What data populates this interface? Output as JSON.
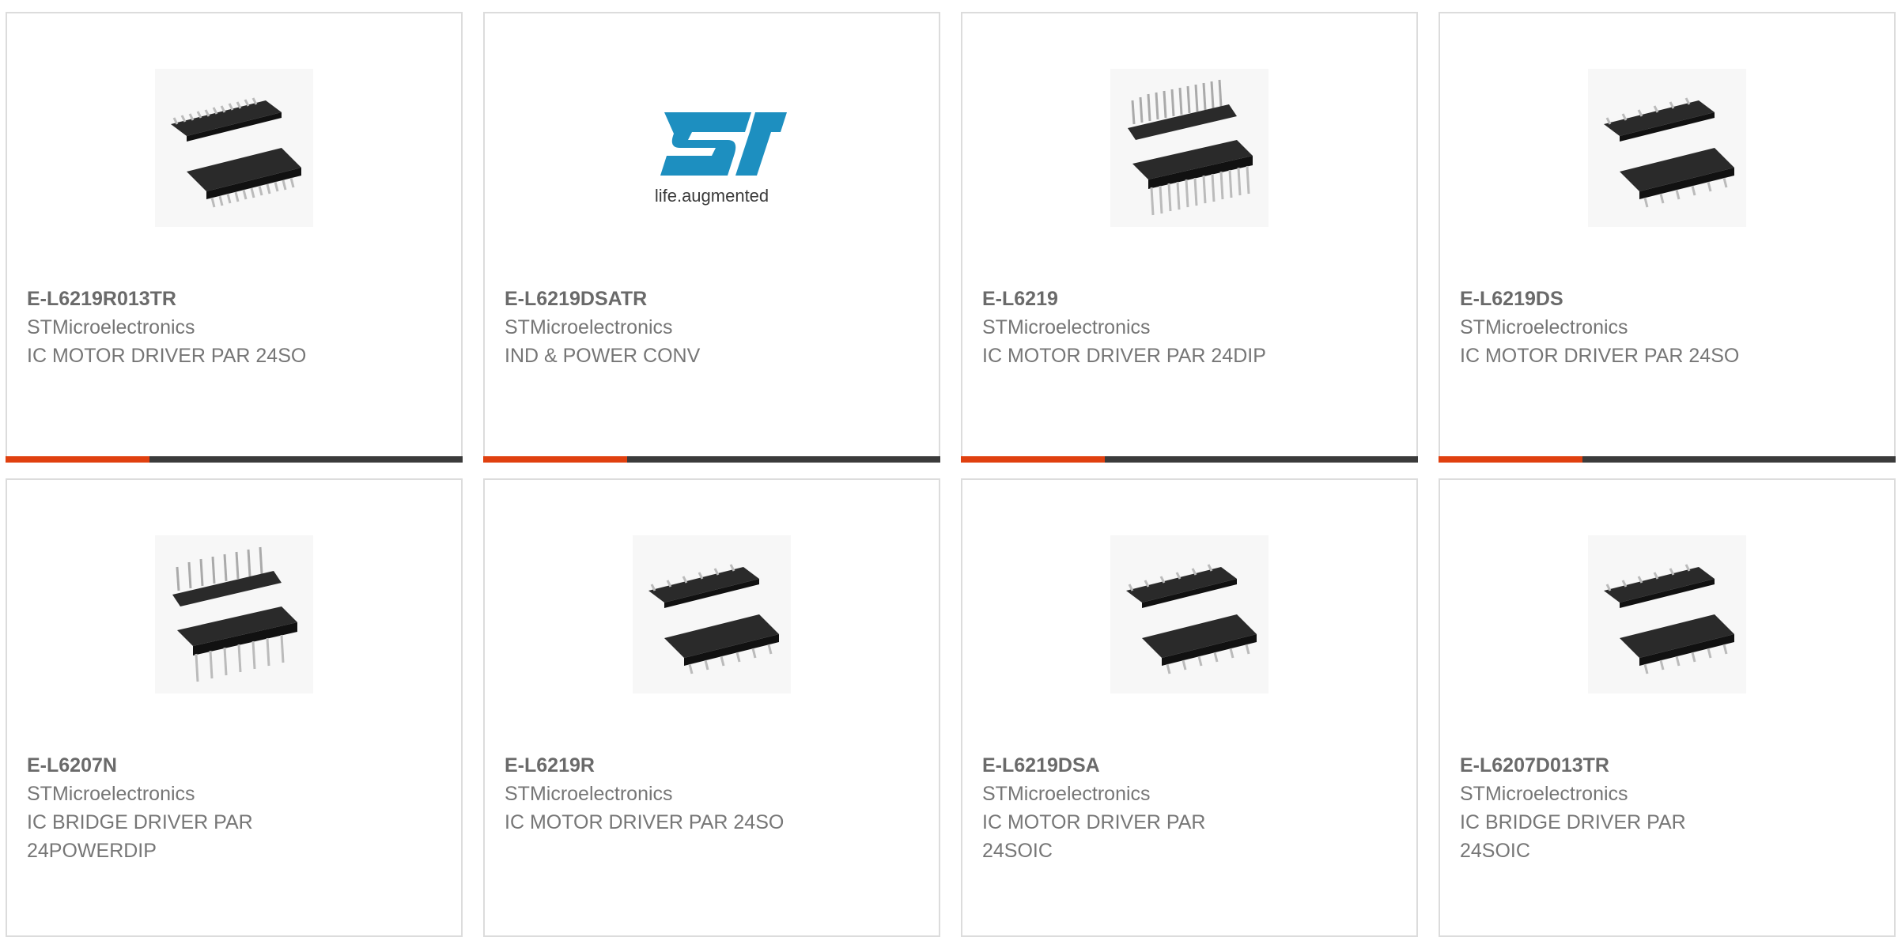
{
  "products": [
    {
      "part": "E-L6219R013TR",
      "manufacturer": "STMicroelectronics",
      "description": "IC MOTOR DRIVER PAR 24SO",
      "image": "soic-chip-icon"
    },
    {
      "part": "E-L6219DSATR",
      "manufacturer": "STMicroelectronics",
      "description": "IND & POWER CONV",
      "image": "st-logo",
      "logo_tagline": "life.augmented",
      "logo_color": "#1d8fc0"
    },
    {
      "part": "E-L6219",
      "manufacturer": "STMicroelectronics",
      "description": "IC MOTOR DRIVER PAR 24DIP",
      "image": "dip-chip-icon"
    },
    {
      "part": "E-L6219DS",
      "manufacturer": "STMicroelectronics",
      "description": "IC MOTOR DRIVER PAR 24SO",
      "image": "soic-chip-icon"
    },
    {
      "part": "E-L6207N",
      "manufacturer": "STMicroelectronics",
      "description": "IC BRIDGE DRIVER PAR 24POWERDIP",
      "image": "dip-chip-icon"
    },
    {
      "part": "E-L6219R",
      "manufacturer": "STMicroelectronics",
      "description": "IC MOTOR DRIVER PAR 24SO",
      "image": "soic-chip-icon"
    },
    {
      "part": "E-L6219DSA",
      "manufacturer": "STMicroelectronics",
      "description": "IC MOTOR DRIVER PAR 24SOIC",
      "image": "soic-chip-icon"
    },
    {
      "part": "E-L6207D013TR",
      "manufacturer": "STMicroelectronics",
      "description": "IC BRIDGE DRIVER PAR 24SOIC",
      "image": "soic-chip-icon"
    }
  ],
  "colors": {
    "accent": "#e0400f",
    "bar": "#3b3b3b",
    "text": "#767676",
    "border": "#dcdcdc"
  }
}
